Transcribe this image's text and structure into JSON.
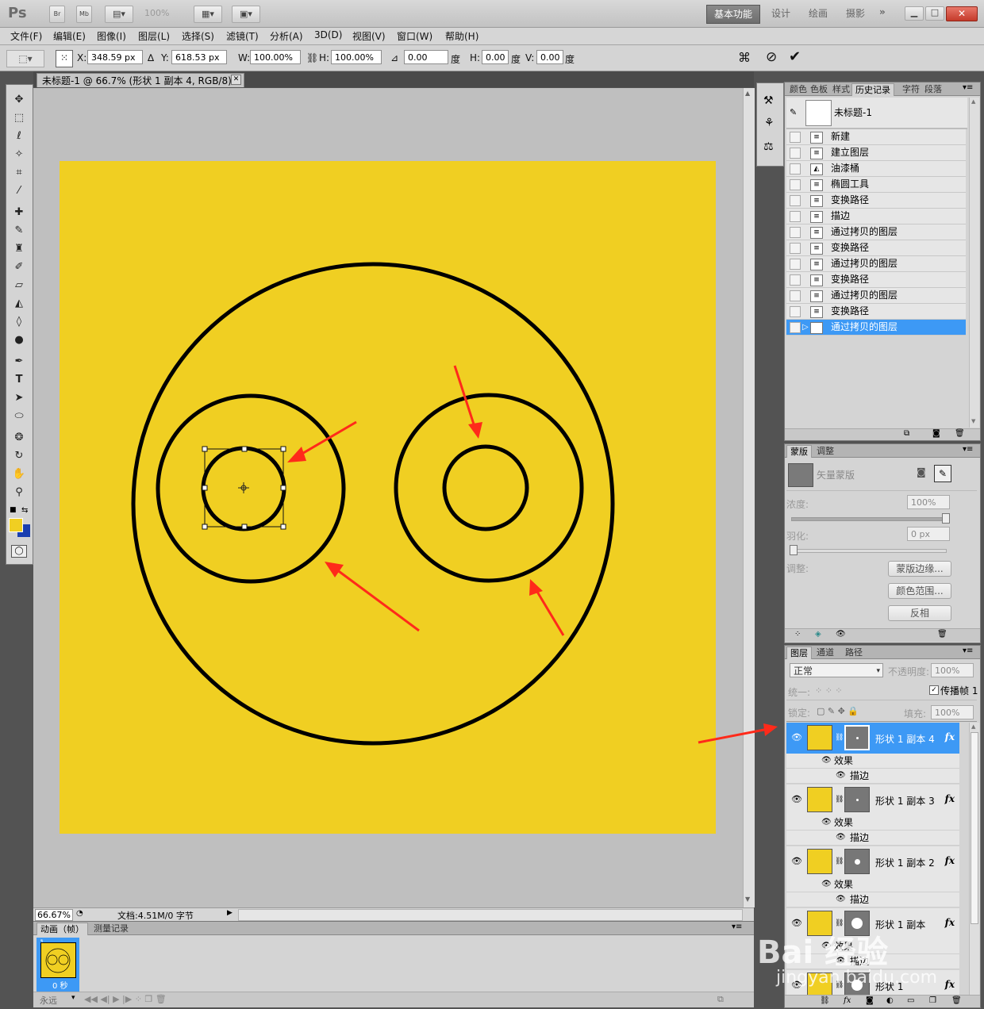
{
  "app": {
    "logo": "Ps",
    "bridge_label": "Br",
    "minibridge_label": "Mb",
    "zoom_select": "100%",
    "workspaces": [
      "基本功能",
      "设计",
      "绘画",
      "摄影"
    ],
    "active_workspace": "基本功能",
    "more_workspaces": "»"
  },
  "menu": [
    "文件(F)",
    "编辑(E)",
    "图像(I)",
    "图层(L)",
    "选择(S)",
    "滤镜(T)",
    "分析(A)",
    "3D(D)",
    "视图(V)",
    "窗口(W)",
    "帮助(H)"
  ],
  "options": {
    "x_label": "X:",
    "x_value": "348.59 px",
    "y_label": "Y:",
    "y_value": "618.53 px",
    "w_label": "W:",
    "w_value": "100.00%",
    "h_label": "H:",
    "h_value": "100.00%",
    "angle_value": "0.00",
    "angle_unit": "度",
    "hskew_label": "H:",
    "hskew_value": "0.00",
    "hskew_unit": "度",
    "vskew_label": "V:",
    "vskew_value": "0.00",
    "vskew_unit": "度"
  },
  "document": {
    "tab_title": "未标题-1 @ 66.7% (形状 1 副本 4, RGB/8) *",
    "zoom": "66.67%",
    "doc_info": "文档:4.51M/0 字节",
    "canvas_color": "#f0cf22"
  },
  "animation": {
    "tabs": [
      "动画（帧）",
      "测量记录"
    ],
    "frame_number": "1",
    "frame_delay": "0 秒",
    "loop": "永远"
  },
  "history": {
    "tabs": [
      "颜色",
      "色板",
      "样式",
      "历史记录",
      "字符",
      "段落"
    ],
    "active_tab": "历史记录",
    "snapshot": "未标题-1",
    "items": [
      "新建",
      "建立图层",
      "油漆桶",
      "椭圆工具",
      "变换路径",
      "描边",
      "通过拷贝的图层",
      "变换路径",
      "通过拷贝的图层",
      "变换路径",
      "通过拷贝的图层",
      "变换路径",
      "通过拷贝的图层"
    ],
    "active_index": 12
  },
  "masks": {
    "tabs": [
      "蒙版",
      "调整"
    ],
    "vector_mask": "矢量蒙版",
    "density_label": "浓度:",
    "density_value": "100%",
    "feather_label": "羽化:",
    "feather_value": "0 px",
    "adjust_label": "调整:",
    "buttons": [
      "蒙版边缘...",
      "颜色范围...",
      "反相"
    ]
  },
  "layers": {
    "tabs": [
      "图层",
      "通道",
      "路径"
    ],
    "blend_mode": "正常",
    "opacity_label": "不透明度:",
    "opacity_value": "100%",
    "unify_label": "统一:",
    "propagate_label": "传播帧 1",
    "lock_label": "锁定:",
    "fill_label": "填充:",
    "fill_value": "100%",
    "effects_label": "效果",
    "stroke_label": "描边",
    "fx_label": "fx",
    "items": [
      {
        "name": "形状 1 副本 4",
        "active": true
      },
      {
        "name": "形状 1 副本 3",
        "active": false
      },
      {
        "name": "形状 1 副本 2",
        "active": false
      },
      {
        "name": "形状 1 副本",
        "active": false
      },
      {
        "name": "形状 1",
        "active": false
      }
    ]
  },
  "watermark": {
    "brand": "Bai 经验",
    "url": "jingyan.baidu.com"
  },
  "colors": {
    "foreground": "#f0cf22",
    "background": "#1a3fb0",
    "selection": "#3d99f5",
    "annotation_arrow": "#ff2a1a"
  }
}
